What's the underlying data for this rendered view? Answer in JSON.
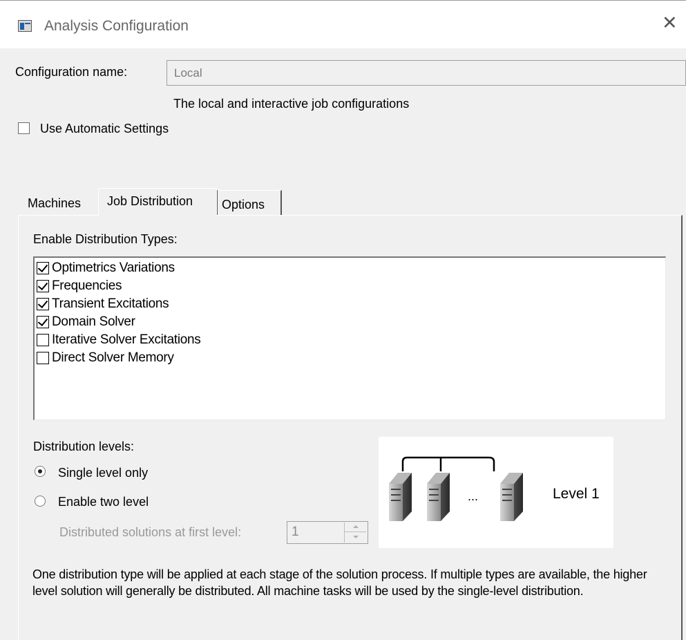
{
  "window": {
    "title": "Analysis Configuration",
    "close_glyph": "✕",
    "icon": "app-window-icon"
  },
  "config": {
    "label": "Configuration name:",
    "value": "Local",
    "description": "The local and interactive job configurations"
  },
  "automatic": {
    "label": "Use Automatic Settings",
    "checked": false
  },
  "tabs": [
    {
      "label": "Machines",
      "active": false
    },
    {
      "label": "Job Distribution",
      "active": true
    },
    {
      "label": "Options",
      "active": false
    }
  ],
  "distribution_types": {
    "label": "Enable Distribution Types:",
    "items": [
      {
        "label": "Optimetrics Variations",
        "checked": true
      },
      {
        "label": "Frequencies",
        "checked": true
      },
      {
        "label": "Transient Excitations",
        "checked": true
      },
      {
        "label": "Domain Solver",
        "checked": true
      },
      {
        "label": "Iterative Solver Excitations",
        "checked": false
      },
      {
        "label": "Direct Solver Memory",
        "checked": false
      }
    ]
  },
  "levels": {
    "label": "Distribution levels:",
    "options": [
      {
        "label": "Single level only",
        "selected": true
      },
      {
        "label": "Enable two level",
        "selected": false
      }
    ],
    "first_level_label": "Distributed solutions at first level:",
    "first_level_value": "1"
  },
  "diagram": {
    "ellipsis": "...",
    "level_label": "Level 1"
  },
  "footer": {
    "text": "One distribution type will be applied at each stage of the solution process. If multiple types are available, the higher level solution will generally be distributed. All machine tasks will be used by the single-level distribution."
  }
}
